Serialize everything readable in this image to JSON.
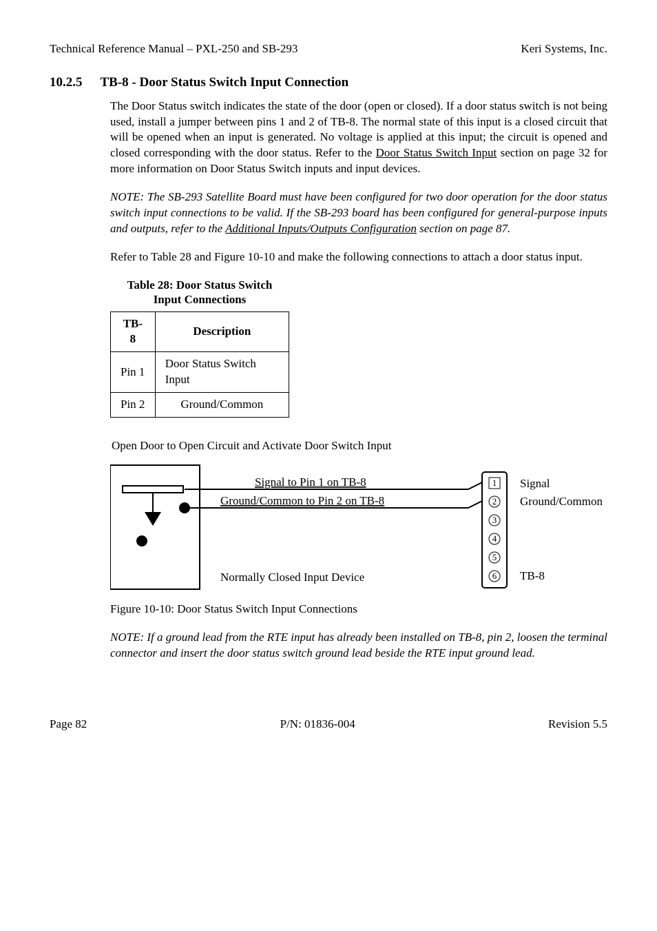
{
  "header": {
    "left": "Technical Reference Manual – PXL-250 and SB-293",
    "right": "Keri Systems, Inc."
  },
  "section": {
    "number": "10.2.5",
    "title": "TB-8 - Door Status Switch Input Connection",
    "p1_a": "The Door Status switch indicates the state of the door (open or closed). If a door status switch is not being used, install a jumper between pins 1 and 2 of TB-8. The normal state of this input is a closed circuit that will be opened when an input is generated. No voltage is applied at this input; the circuit is opened and closed corresponding with the door status. Refer to the ",
    "p1_link": "Door Status Switch Input",
    "p1_b": " section on page 32 for more information on Door Status Switch inputs and input devices.",
    "note1_a": "NOTE: The SB-293 Satellite Board must have been configured for two door operation for the door status switch input connections to be valid. If the SB-293 board has been configured for general-purpose inputs and outputs, refer to the ",
    "note1_link": "Additional Inputs/Outputs Configuration",
    "note1_b": " section on page 87.",
    "p2": "Refer to Table 28 and Figure 10-10 and make the following connections to attach a door status input."
  },
  "table": {
    "caption_l1": "Table 28: Door Status Switch",
    "caption_l2": "Input Connections",
    "h1": "TB-8",
    "h2": "Description",
    "r1c1": "Pin 1",
    "r1c2": "Door Status Switch Input",
    "r2c1": "Pin 2",
    "r2c2": "Ground/Common"
  },
  "figure": {
    "top_text": "Open Door to Open Circuit and Activate Door Switch Input",
    "sig_line": "Signal to Pin 1 on TB-8",
    "gnd_line": "Ground/Common to Pin 2 on TB-8",
    "device": "Normally Closed Input Device",
    "tb_sig": "Signal",
    "tb_gnd": "Ground/Common",
    "tb_label": "TB-8",
    "caption": "Figure 10-10: Door Status Switch Input Connections",
    "pins": [
      "1",
      "2",
      "3",
      "4",
      "5",
      "6"
    ]
  },
  "note2": "NOTE: If a ground lead from the RTE input has already been installed on TB-8, pin 2, loosen the terminal connector and insert the door status switch ground lead beside the RTE input ground lead.",
  "footer": {
    "left": "Page 82",
    "center": "P/N: 01836-004",
    "right": "Revision 5.5"
  }
}
